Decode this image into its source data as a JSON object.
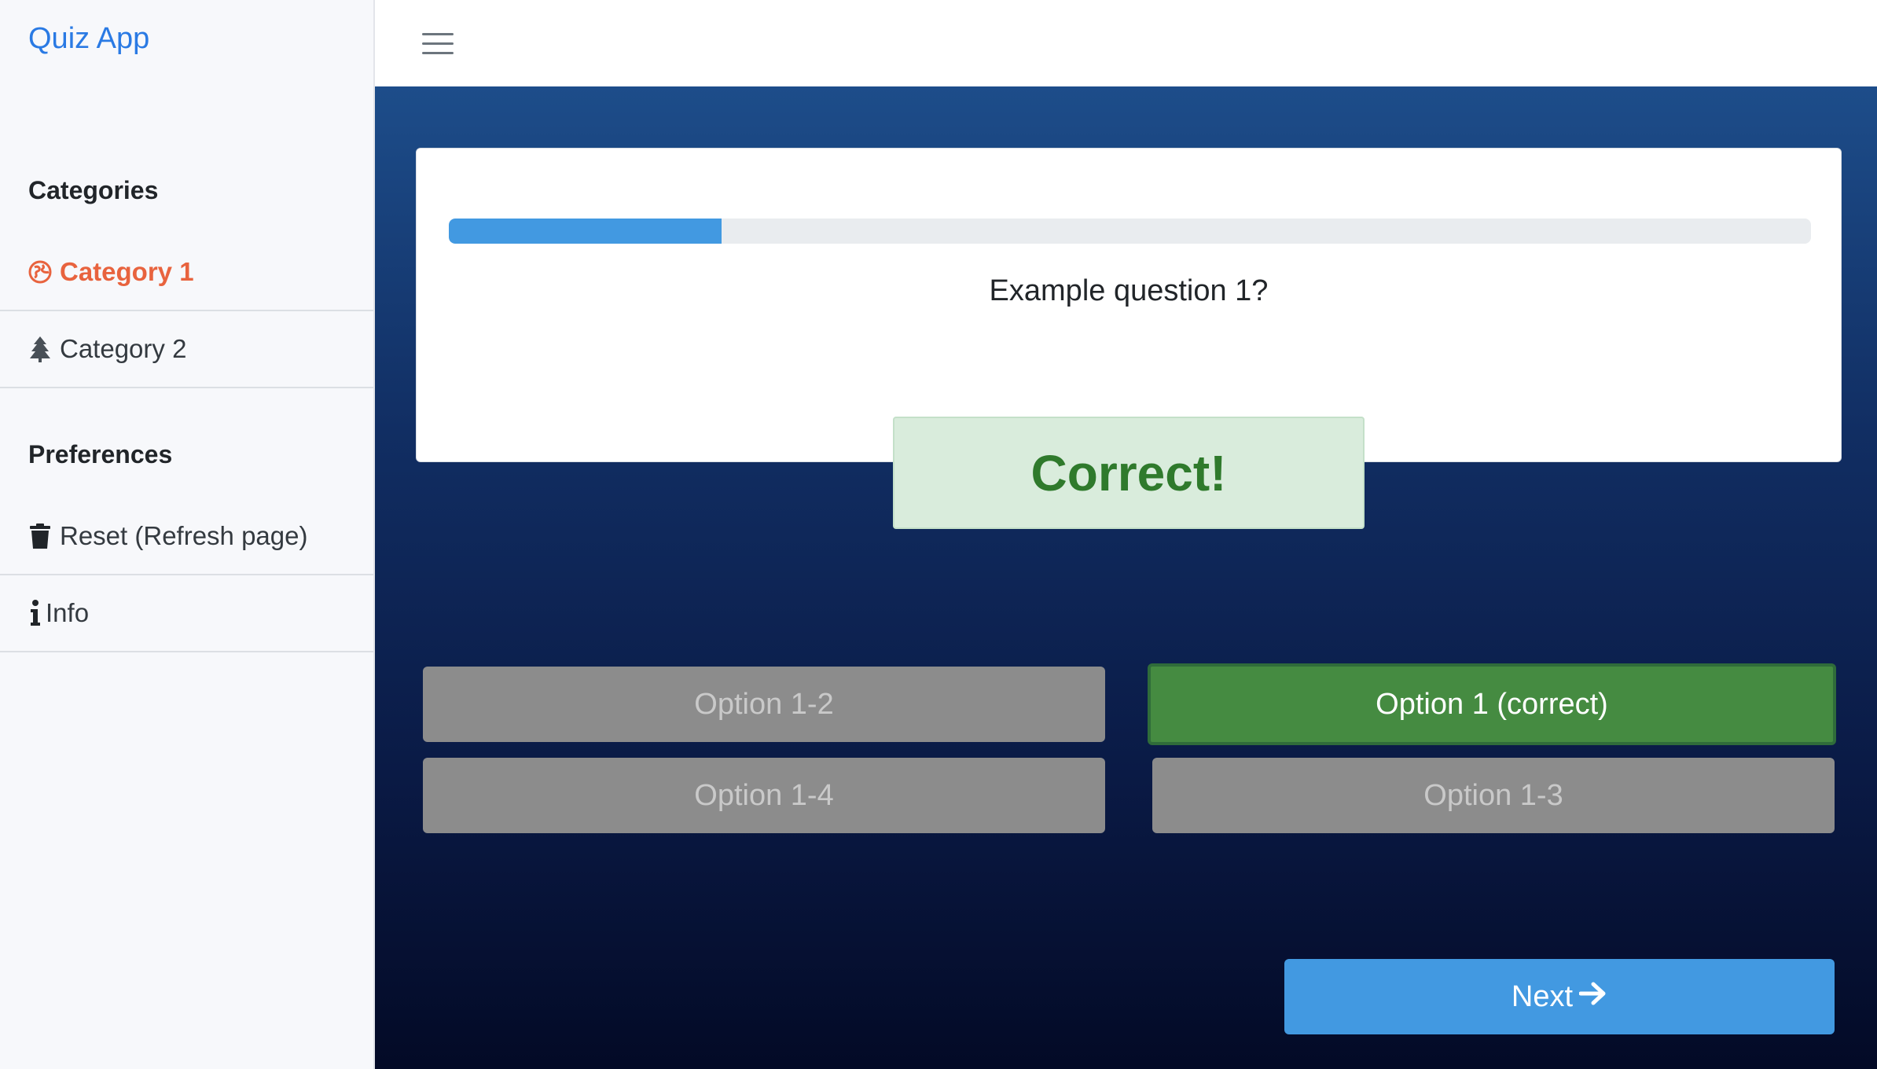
{
  "sidebar": {
    "brand": "Quiz App",
    "categories_heading": "Categories",
    "categories": [
      {
        "label": "Category 1",
        "icon": "globe-icon",
        "active": true
      },
      {
        "label": "Category 2",
        "icon": "tree-icon",
        "active": false
      }
    ],
    "preferences_heading": "Preferences",
    "preferences": [
      {
        "label": "Reset (Refresh page)",
        "icon": "trash-icon"
      },
      {
        "label": "Info",
        "icon": "info-icon"
      }
    ]
  },
  "header": {
    "menu_icon": "hamburger-menu-icon"
  },
  "quiz": {
    "progress": 0.2,
    "question": "Example question 1?",
    "feedback": "Correct!",
    "options": [
      {
        "label": "Option 1-2",
        "state": "disabled"
      },
      {
        "label": "Option 1 (correct)",
        "state": "correct"
      },
      {
        "label": "Option 1-4",
        "state": "disabled"
      },
      {
        "label": "Option 1-3",
        "state": "disabled"
      }
    ],
    "next_label": "Next"
  },
  "colors": {
    "brand": "#2a7ae4",
    "active_category": "#e8633e",
    "progress": "#4299e1",
    "correct": "#458b41",
    "disabled": "#8c8c8c",
    "next": "#4299e1"
  }
}
